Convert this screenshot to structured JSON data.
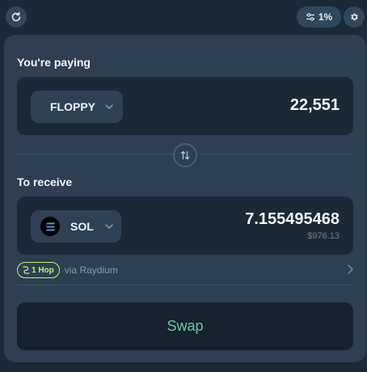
{
  "header": {
    "slippage_label": "1%",
    "icons": [
      "refresh-icon",
      "sliders-icon",
      "gear-icon"
    ]
  },
  "pay": {
    "label": "You're paying",
    "token": "FLOPPY",
    "amount": "22,551"
  },
  "receive": {
    "label": "To receive",
    "token": "SOL",
    "amount": "7.155495468",
    "usd_value": "$976.13"
  },
  "route": {
    "hops": "1 Hop",
    "via": "via Raydium"
  },
  "swap_button": "Swap",
  "colors": {
    "background": "#1c2936",
    "panel": "#2d3f51",
    "input_box": "#1b2937",
    "accent_green": "#c6ed75",
    "swap_text": "#6cc5a0"
  }
}
